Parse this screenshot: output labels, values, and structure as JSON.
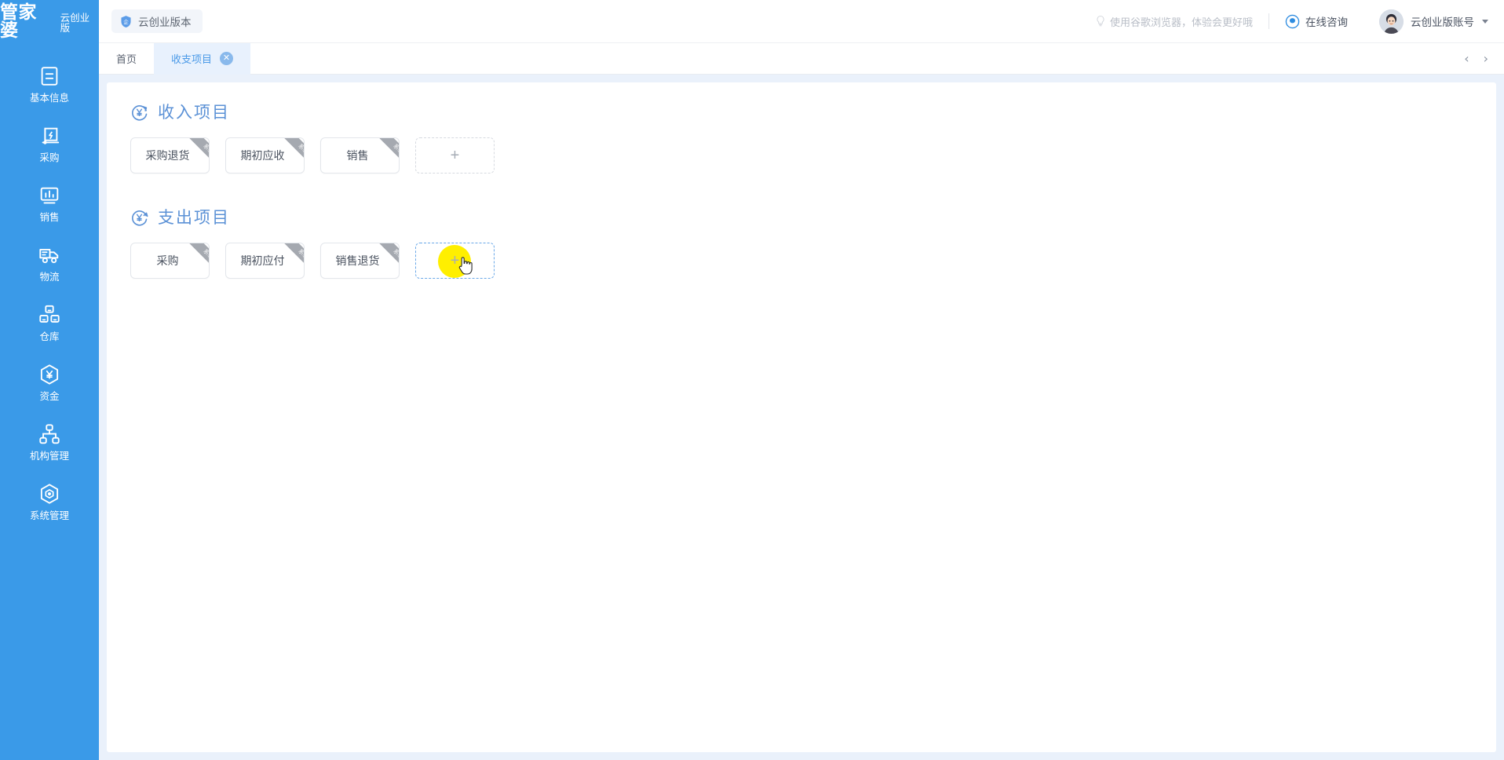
{
  "header": {
    "brand_main": "管家婆",
    "brand_sub": "云创业版",
    "version_chip": "云创业版本",
    "shield_icon": "shield-icon",
    "browser_tip": "使用谷歌浏览器，体验会更好哦",
    "bulb_icon": "bulb-icon",
    "consult_label": "在线咨询",
    "consult_icon": "chat-bubble-icon",
    "account_label": "云创业版账号",
    "avatar_icon": "user-avatar",
    "caret_icon": "chevron-down-icon"
  },
  "sidebar": {
    "items": [
      {
        "label": "基本信息",
        "icon": "document-list-icon"
      },
      {
        "label": "采购",
        "icon": "purchase-box-icon"
      },
      {
        "label": "销售",
        "icon": "monitor-chart-icon"
      },
      {
        "label": "物流",
        "icon": "truck-icon"
      },
      {
        "label": "仓库",
        "icon": "warehouse-boxes-icon"
      },
      {
        "label": "资金",
        "icon": "hexagon-yuan-icon"
      },
      {
        "label": "机构管理",
        "icon": "org-tree-icon"
      },
      {
        "label": "系统管理",
        "icon": "hexagon-gear-icon"
      }
    ]
  },
  "tabstrip": {
    "tabs": [
      {
        "label": "首页",
        "active": false,
        "closable": false
      },
      {
        "label": "收支项目",
        "active": true,
        "closable": true
      }
    ],
    "close_glyph": "✕",
    "prev_glyph": "‹",
    "next_glyph": "›",
    "prev_icon": "chevron-left-icon",
    "next_icon": "chevron-right-icon"
  },
  "main": {
    "sections": [
      {
        "key": "income",
        "title": "收入项目",
        "icon": "yuan-circle-in-icon",
        "cards": [
          {
            "label": "采购退货",
            "ribbon": "系统"
          },
          {
            "label": "期初应收",
            "ribbon": "系统"
          },
          {
            "label": "销售",
            "ribbon": "系统"
          }
        ],
        "add_glyph": "+",
        "add_hovered": false
      },
      {
        "key": "expense",
        "title": "支出项目",
        "icon": "yuan-circle-out-icon",
        "cards": [
          {
            "label": "采购",
            "ribbon": "系统"
          },
          {
            "label": "期初应付",
            "ribbon": "系统"
          },
          {
            "label": "销售退货",
            "ribbon": "系统"
          }
        ],
        "add_glyph": "+",
        "add_hovered": true
      }
    ]
  },
  "colors": {
    "brand_blue": "#3a9ae8",
    "title_blue": "#5b91d6",
    "tab_active_bg": "#e8f1fd",
    "content_bg": "#eaf1fb",
    "ribbon_gray": "#a5a9b0",
    "cursor_highlight": "#ffef00"
  }
}
